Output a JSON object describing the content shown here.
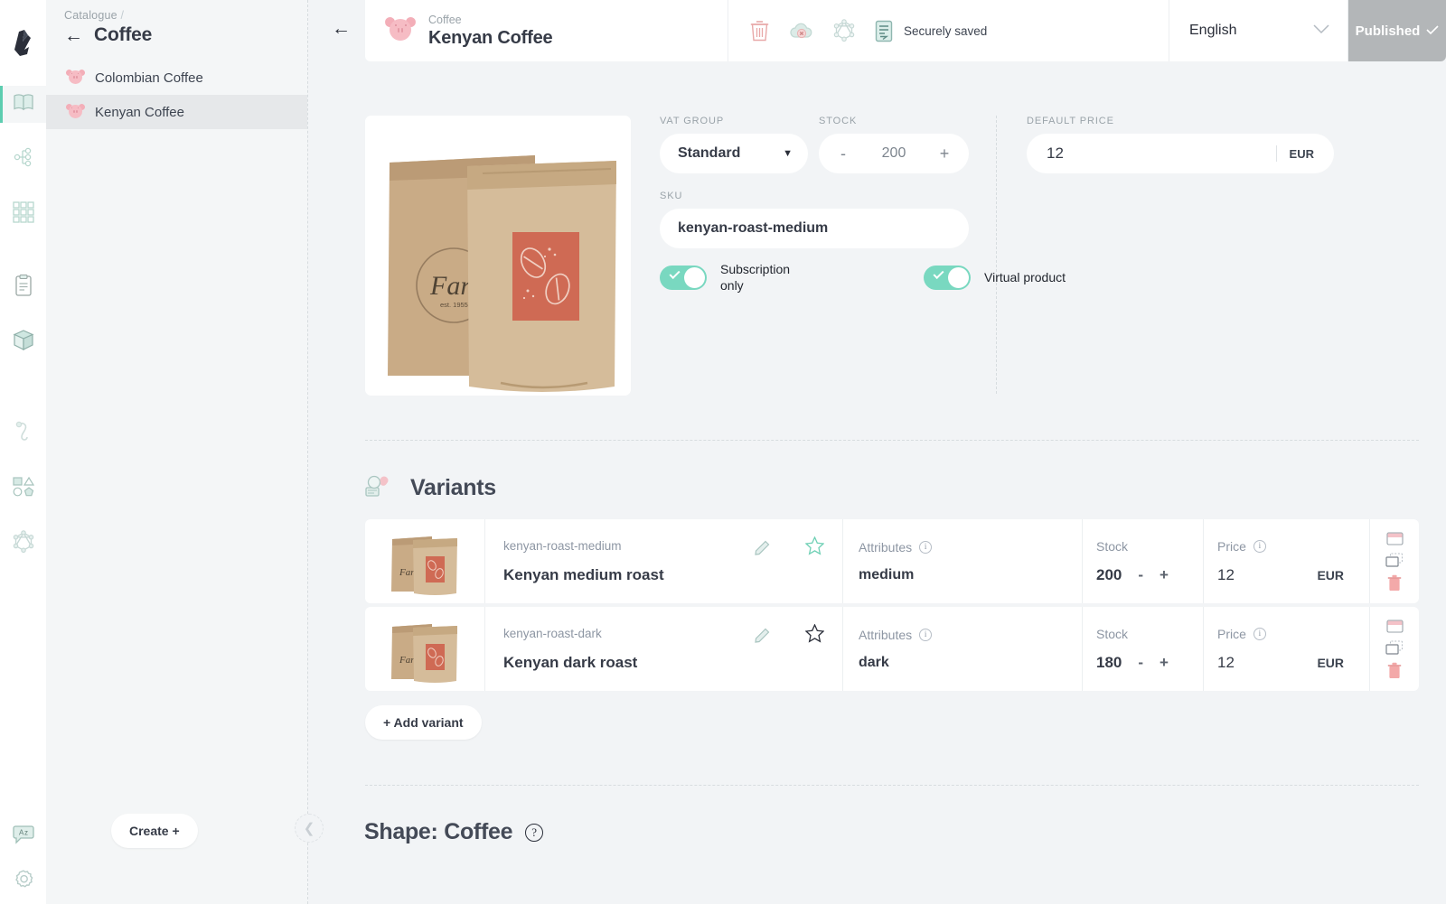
{
  "rail": {
    "logo_icon": "crystallize-logo-icon",
    "items": [
      {
        "icon": "catalogue-book-icon",
        "name": "catalogue",
        "active": true
      },
      {
        "icon": "hierarchy-tree-icon",
        "name": "topics",
        "active": false
      },
      {
        "icon": "grid-squares-icon",
        "name": "grid",
        "active": false
      },
      {
        "icon": "clipboard-document-icon",
        "name": "documents",
        "active": false
      },
      {
        "icon": "box-3d-icon",
        "name": "products",
        "active": false
      },
      {
        "icon": "hook-icon",
        "name": "webhooks",
        "active": false
      },
      {
        "icon": "shapes-icon",
        "name": "shapes",
        "active": false
      },
      {
        "icon": "graphql-icon",
        "name": "api",
        "active": false
      }
    ],
    "bottom": [
      {
        "icon": "translate-bubble-icon",
        "name": "language"
      },
      {
        "icon": "gear-icon",
        "name": "settings"
      }
    ]
  },
  "pane": {
    "breadcrumb": "Catalogue",
    "breadcrumb_separator": "/",
    "back_icon": "arrow-left-icon",
    "title": "Coffee",
    "items": [
      {
        "label": "Colombian Coffee",
        "icon": "pig-icon",
        "selected": false
      },
      {
        "label": "Kenyan Coffee",
        "icon": "pig-icon",
        "selected": true
      }
    ],
    "create_label": "Create +",
    "collapse_icon": "chevron-left-icon"
  },
  "topbar": {
    "back_icon": "arrow-left-icon",
    "product_icon": "pig-icon",
    "product_subtitle": "Coffee",
    "product_title": "Kenyan Coffee",
    "actions": [
      {
        "icon": "trash-icon",
        "name": "delete-product"
      },
      {
        "icon": "cloud-unpublish-icon",
        "name": "unpublish"
      },
      {
        "icon": "graphql-icon",
        "name": "api-explorer"
      },
      {
        "icon": "document-saved-icon",
        "name": "saved-status"
      }
    ],
    "saved_label": "Securely saved",
    "language": "English",
    "language_caret_icon": "chevron-down-icon",
    "publish_label": "Published",
    "publish_check_icon": "check-icon"
  },
  "product": {
    "image_alt": "two kraft coffee pouches with red label",
    "vat_label": "VAT GROUP",
    "vat_value": "Standard",
    "vat_caret_icon": "caret-down-icon",
    "stock_label": "STOCK",
    "stock_value": "200",
    "stock_minus": "-",
    "stock_plus": "+",
    "sku_label": "SKU",
    "sku_value": "kenyan-roast-medium",
    "price_label": "DEFAULT PRICE",
    "price_value": "12",
    "price_currency": "EUR",
    "toggles": [
      {
        "label": "Subscription only",
        "on": true,
        "name": "subscription-only-toggle"
      },
      {
        "label": "Virtual product",
        "on": true,
        "name": "virtual-product-toggle"
      }
    ]
  },
  "variants": {
    "icon": "variants-icon",
    "title": "Variants",
    "columns": {
      "attributes": "Attributes",
      "stock": "Stock",
      "price": "Price"
    },
    "rows": [
      {
        "sku": "kenyan-roast-medium",
        "name": "Kenyan medium roast",
        "attributes": "medium",
        "stock": "200",
        "price": "12",
        "currency": "EUR",
        "favorite": true,
        "thumb_alt": "coffee pouch thumbnail"
      },
      {
        "sku": "kenyan-roast-dark",
        "name": "Kenyan dark roast",
        "attributes": "dark",
        "stock": "180",
        "price": "12",
        "currency": "EUR",
        "favorite": false,
        "thumb_alt": "coffee pouch thumbnail"
      }
    ],
    "row_actions": [
      {
        "icon": "image-card-icon",
        "name": "edit-image"
      },
      {
        "icon": "duplicate-icon",
        "name": "duplicate-variant"
      },
      {
        "icon": "trash-icon",
        "name": "delete-variant"
      }
    ],
    "edit_icon": "pencil-icon",
    "star_icon": "star-icon",
    "info_icon": "info-icon",
    "stock_minus": "-",
    "stock_plus": "+",
    "add_variant_label": "+ Add variant"
  },
  "shape": {
    "title": "Shape: Coffee",
    "help_icon": "question-mark-icon"
  },
  "colors": {
    "accent_teal": "#5dcdb0",
    "toggle_on": "#79d8c0",
    "pig_pink": "#f6bcc4",
    "publish_grey": "#b3b6b8",
    "page_bg": "#f2f4f6",
    "label_grey": "#9aa3a9",
    "text_dark": "#363b47",
    "label_red": "#cf6a54"
  }
}
